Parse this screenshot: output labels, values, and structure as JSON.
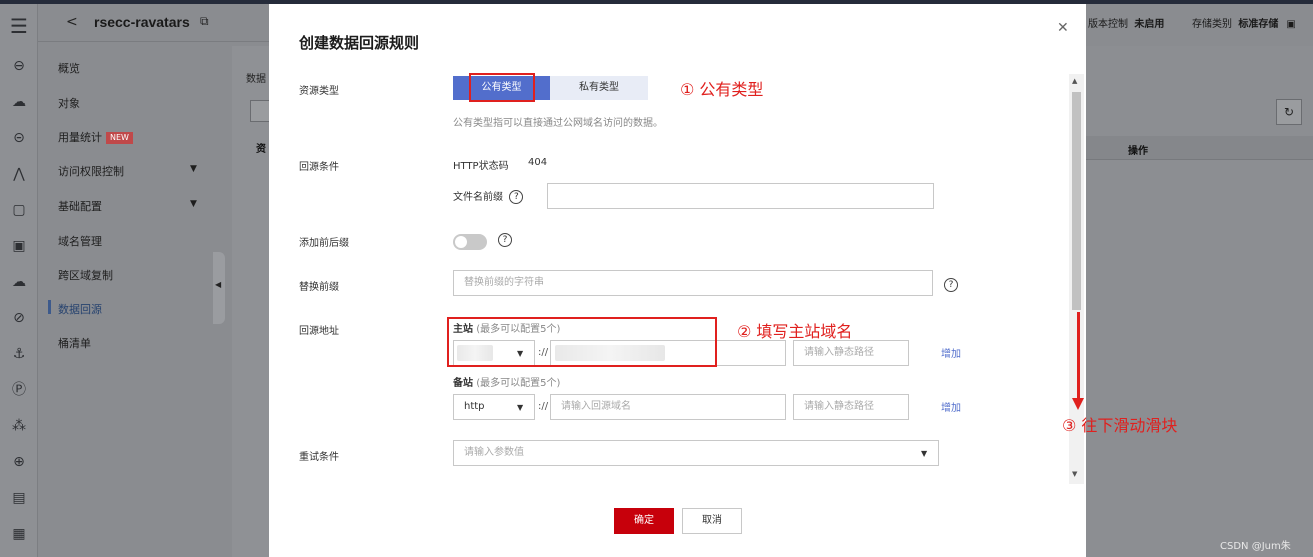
{
  "header": {
    "back_icon": "chevron-left-icon",
    "bucket_name": "rsecc-ravatars",
    "copy_icon": "copy-icon",
    "version_control_label": "版本控制",
    "version_control_value": "未启用",
    "storage_class_label": "存储类别",
    "storage_class_value": "标准存储"
  },
  "sidebar": {
    "items": [
      {
        "label": "概览"
      },
      {
        "label": "对象"
      },
      {
        "label": "用量统计",
        "badge": "NEW"
      },
      {
        "label": "访问权限控制"
      },
      {
        "label": "基础配置"
      },
      {
        "label": "域名管理"
      },
      {
        "label": "跨区域复制"
      },
      {
        "label": "数据回源"
      },
      {
        "label": "桶清单"
      }
    ]
  },
  "background": {
    "partial_text": "数据",
    "table_header_partial": "资",
    "refresh_icon": "refresh-icon",
    "col_operation": "操作"
  },
  "modal": {
    "title": "创建数据回源规则",
    "close_icon": "close-icon",
    "resource_type": {
      "label": "资源类型",
      "options": [
        "公有类型",
        "私有类型"
      ],
      "selected": "公有类型",
      "hint": "公有类型指可以直接通过公网域名访问的数据。"
    },
    "condition": {
      "label": "回源条件",
      "status_code_label": "HTTP状态码",
      "status_code_value": "404",
      "prefix_label": "文件名前缀",
      "prefix_value": ""
    },
    "add_prefix_suffix": {
      "label": "添加前后缀",
      "enabled": false
    },
    "replace_prefix": {
      "label": "替换前缀",
      "placeholder": "替换前缀的字符串"
    },
    "origin_address": {
      "label": "回源地址",
      "primary_label": "主站",
      "primary_note": "(最多可以配置5个)",
      "separator": "://",
      "primary_path_placeholder": "请输入静态路径",
      "add_link": "增加",
      "backup_label": "备站",
      "backup_note": "(最多可以配置5个)",
      "backup_protocol": "http",
      "backup_domain_placeholder": "请输入回源域名",
      "backup_path_placeholder": "请输入静态路径"
    },
    "retry": {
      "label": "重试条件",
      "placeholder": "请输入参数值"
    },
    "ok_label": "确定",
    "cancel_label": "取消"
  },
  "annotations": {
    "a1": "① 公有类型",
    "a2": "② 填写主站域名",
    "a3": "③ 往下滑动滑块"
  },
  "watermark": "CSDN @Jum朱",
  "colors": {
    "primary": "#526ecc",
    "danger": "#c7000b",
    "annotation": "#e0201e"
  }
}
